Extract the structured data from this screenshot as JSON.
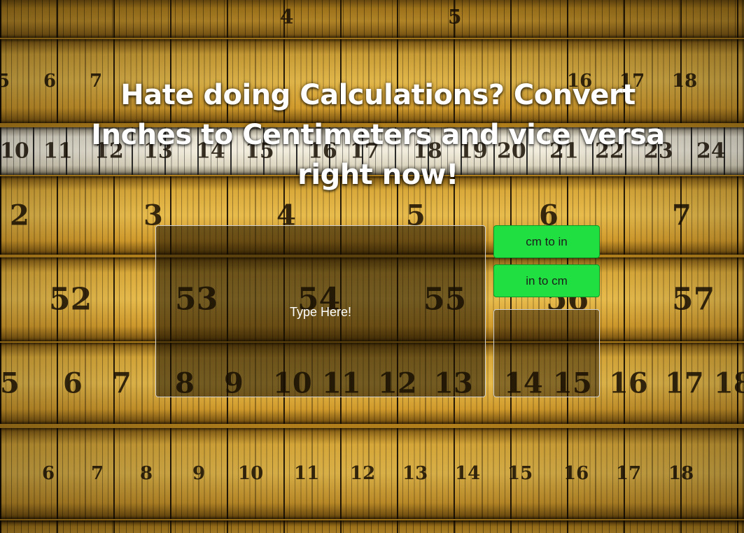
{
  "page": {
    "title": "Hate doing Calculations? Convert Inches to Centimeters and vice versa right now!"
  },
  "converter": {
    "input_placeholder": "Type Here!",
    "input_value": "",
    "button_cm_to_in": "cm to in",
    "button_in_to_cm": "in to cm",
    "result_value": ""
  },
  "colors": {
    "button_green": "#1fe040",
    "title_text": "#ffffff",
    "background_gold": "#c89a2a"
  }
}
